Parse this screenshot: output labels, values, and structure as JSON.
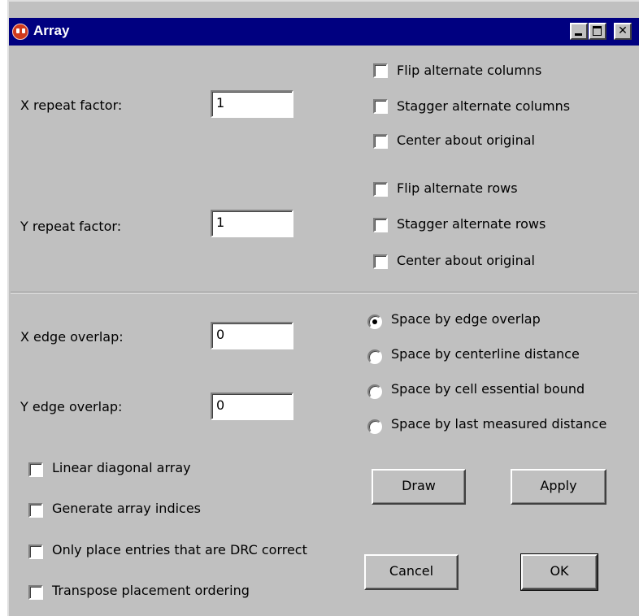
{
  "window": {
    "title": "Array",
    "colors": {
      "titlebar": "#000080",
      "face": "#c0c0c0"
    }
  },
  "repeat": {
    "x_label": "X repeat factor:",
    "x_value": "1",
    "y_label": "Y repeat factor:",
    "y_value": "1"
  },
  "column_options": [
    {
      "label": "Flip alternate columns",
      "checked": false
    },
    {
      "label": "Stagger alternate columns",
      "checked": false
    },
    {
      "label": "Center about original",
      "checked": false
    }
  ],
  "row_options": [
    {
      "label": "Flip alternate rows",
      "checked": false
    },
    {
      "label": "Stagger alternate rows",
      "checked": false
    },
    {
      "label": "Center about original",
      "checked": false
    }
  ],
  "overlap": {
    "x_label": "X edge overlap:",
    "x_value": "0",
    "y_label": "Y edge overlap:",
    "y_value": "0"
  },
  "spacing_options": [
    {
      "label": "Space by edge overlap",
      "selected": true
    },
    {
      "label": "Space by centerline distance",
      "selected": false
    },
    {
      "label": "Space by cell essential bound",
      "selected": false
    },
    {
      "label": "Space by last measured distance",
      "selected": false
    }
  ],
  "misc_options": [
    {
      "label": "Linear diagonal array",
      "checked": false
    },
    {
      "label": "Generate array indices",
      "checked": false
    },
    {
      "label": "Only place entries that are DRC correct",
      "checked": false
    },
    {
      "label": "Transpose placement ordering",
      "checked": false
    }
  ],
  "buttons": {
    "draw": "Draw",
    "apply": "Apply",
    "cancel": "Cancel",
    "ok": "OK"
  },
  "icons": {
    "title": "app-icon",
    "minimize": "minimize-icon",
    "maximize": "maximize-icon",
    "close": "close-icon"
  }
}
